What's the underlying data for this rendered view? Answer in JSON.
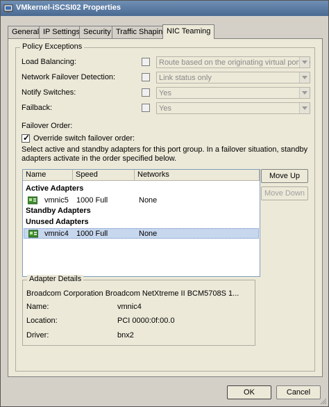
{
  "window": {
    "title": "VMkernel-iSCSI02 Properties"
  },
  "tabs": [
    {
      "label": "General"
    },
    {
      "label": "IP Settings"
    },
    {
      "label": "Security"
    },
    {
      "label": "Traffic Shaping"
    },
    {
      "label": "NIC Teaming"
    }
  ],
  "policy": {
    "group_title": "Policy Exceptions",
    "load_balancing": {
      "label": "Load Balancing:",
      "checked": false,
      "value": "Route based on the originating virtual port ID"
    },
    "failover_detection": {
      "label": "Network Failover Detection:",
      "checked": false,
      "value": "Link status only"
    },
    "notify_switches": {
      "label": "Notify Switches:",
      "checked": false,
      "value": "Yes"
    },
    "failback": {
      "label": "Failback:",
      "checked": false,
      "value": "Yes"
    },
    "failover_order_label": "Failover Order:",
    "override": {
      "label": "Override switch failover order:",
      "checked": true,
      "mark": "✓"
    },
    "instructions": "Select active and standby adapters for this port group.  In a failover situation, standby adapters activate  in the order specified below."
  },
  "adapters": {
    "columns": [
      "Name",
      "Speed",
      "Networks"
    ],
    "groups": {
      "active": "Active Adapters",
      "standby": "Standby Adapters",
      "unused": "Unused Adapters"
    },
    "active_rows": [
      {
        "name": "vmnic5",
        "speed": "1000 Full",
        "networks": "None"
      }
    ],
    "unused_rows": [
      {
        "name": "vmnic4",
        "speed": "1000 Full",
        "networks": "None",
        "selected": true
      }
    ]
  },
  "buttons": {
    "move_up": "Move Up",
    "move_down": "Move Down",
    "ok": "OK",
    "cancel": "Cancel"
  },
  "details": {
    "group_title": "Adapter Details",
    "description": "Broadcom Corporation Broadcom NetXtreme II BCM5708S 1...",
    "name_label": "Name:",
    "name_value": "vmnic4",
    "location_label": "Location:",
    "location_value": "PCI 0000:0f:00.0",
    "driver_label": "Driver:",
    "driver_value": "bnx2"
  },
  "colors": {
    "title_bar": "#4b6a93",
    "selection": "#c7d7ee",
    "nic_icon": "#3d8f2e"
  }
}
